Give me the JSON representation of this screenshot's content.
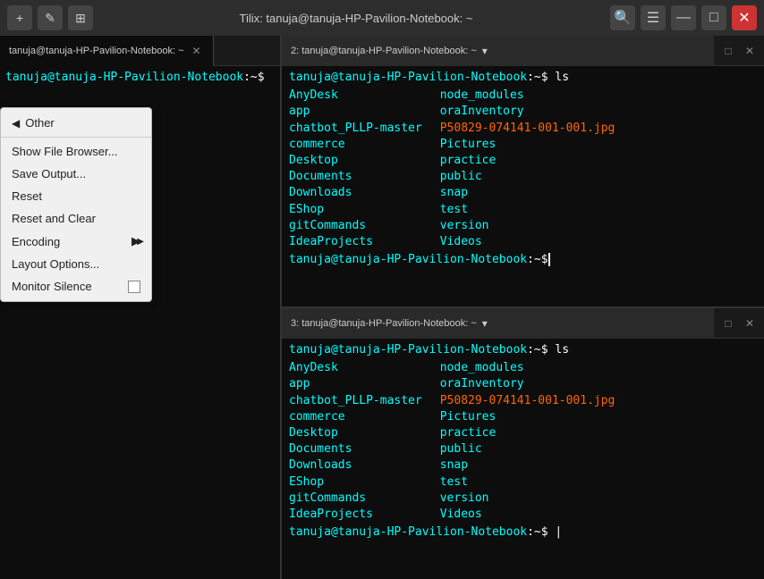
{
  "titleBar": {
    "title": "Tilix: tanuja@tanuja-HP-Pavilion-Notebook: ~",
    "buttons": {
      "newWindow": "+",
      "rename": "✎",
      "newTerminal": "⊞",
      "search": "🔍",
      "menu": "☰",
      "minimize": "—",
      "maximize": "□",
      "close": "✕"
    }
  },
  "leftPane": {
    "tab": {
      "label": "tanuja@tanuja-HP-Pavilion-Notebook: ~",
      "number": "1"
    },
    "terminal": {
      "prompt": "tanuja@tanuja-HP-Pavilion-Notebook",
      "promptSuffix": ":~$",
      "command": ""
    }
  },
  "rightTopPane": {
    "tab": {
      "label": "2: tanuja@tanuja-HP-Pavilion-Notebook: ~",
      "hasDropdown": true
    },
    "terminal": {
      "prompt": "tanuja@tanuja-HP-Pavilion-Notebook",
      "promptSuffix": ":~$",
      "command": "ls",
      "files": {
        "col1": [
          "AnyDesk",
          "app",
          "chatbot_PLLP-master",
          "commerce",
          "Desktop",
          "Documents",
          "Downloads",
          "EShop",
          "gitCommands",
          "IdeaProjects"
        ],
        "col2": [
          "node_modules",
          "oraInventory",
          "P50829-074141-001-001.jpg",
          "Pictures",
          "practice",
          "public",
          "snap",
          "test",
          "version",
          "Videos"
        ]
      }
    }
  },
  "rightBottomPane": {
    "tab": {
      "label": "3: tanuja@tanuja-HP-Pavilion-Notebook: ~",
      "hasDropdown": true
    },
    "terminal": {
      "prompt": "tanuja@tanuja-HP-Pavilion-Notebook",
      "promptSuffix": ":~$",
      "command": "ls",
      "files": {
        "col1": [
          "AnyDesk",
          "app",
          "chatbot_PLLP-master",
          "commerce",
          "Desktop",
          "Documents",
          "Downloads",
          "EShop",
          "gitCommands",
          "IdeaProjects"
        ],
        "col2": [
          "node_modules",
          "oraInventory",
          "P50829-074141-001-001.jpg",
          "Pictures",
          "practice",
          "public",
          "snap",
          "test",
          "version",
          "Videos"
        ]
      }
    },
    "promptEnd": {
      "text": "tanuja@tanuja-HP-Pavilion-Notebook",
      "suffix": ":~$"
    }
  },
  "contextMenu": {
    "items": [
      {
        "id": "back",
        "label": "Other",
        "isBack": true
      },
      {
        "id": "show-file-browser",
        "label": "Show File Browser..."
      },
      {
        "id": "save-output",
        "label": "Save Output..."
      },
      {
        "id": "reset",
        "label": "Reset"
      },
      {
        "id": "reset-and-clear",
        "label": "Reset and Clear"
      },
      {
        "id": "encoding",
        "label": "Encoding",
        "hasSubmenu": true
      },
      {
        "id": "layout-options",
        "label": "Layout Options..."
      },
      {
        "id": "monitor-silence",
        "label": "Monitor Silence",
        "hasCheckbox": true
      }
    ]
  }
}
